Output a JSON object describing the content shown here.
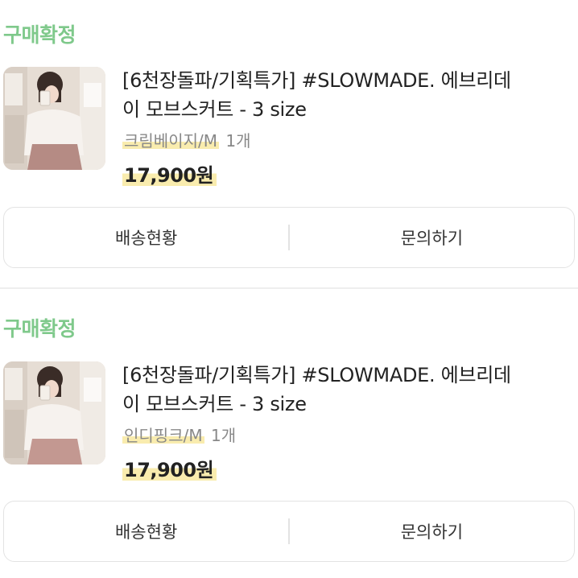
{
  "orders": [
    {
      "status": "구매확정",
      "title_line1": "[6천장돌파/기획특가] #SLOWMADE. 에브리데",
      "title_line2": "이 모브스커트 - 3 size",
      "option": "크림베이지/M",
      "quantity": "1개",
      "price": "17,900원",
      "actions": {
        "shipping": "배송현황",
        "inquiry": "문의하기"
      }
    },
    {
      "status": "구매확정",
      "title_line1": "[6천장돌파/기획특가] #SLOWMADE. 에브리데",
      "title_line2": "이 모브스커트 - 3 size",
      "option": "인디핑크/M",
      "quantity": "1개",
      "price": "17,900원",
      "actions": {
        "shipping": "배송현황",
        "inquiry": "문의하기"
      }
    }
  ],
  "colors": {
    "status_green": "#7fc98b",
    "highlight_yellow": "#f9ecae",
    "border": "#e3e3e3"
  }
}
